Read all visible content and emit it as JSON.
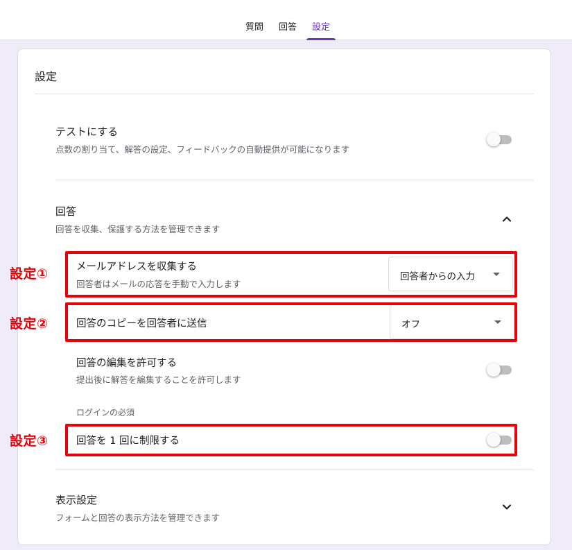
{
  "tabs": [
    {
      "label": "質問"
    },
    {
      "label": "回答"
    },
    {
      "label": "設定"
    }
  ],
  "settings_title": "設定",
  "quiz": {
    "title": "テストにする",
    "desc": "点数の割り当て、解答の設定、フィードバックの自動提供が可能になります",
    "toggle_on": false
  },
  "responses": {
    "title": "回答",
    "desc": "回答を収集、保護する方法を管理できます",
    "expanded": true,
    "collect_email": {
      "title": "メールアドレスを収集する",
      "desc": "回答者はメールの応答を手動で入力します",
      "value": "回答者からの入力"
    },
    "send_copy": {
      "title": "回答のコピーを回答者に送信",
      "value": "オフ"
    },
    "allow_edit": {
      "title": "回答の編集を許可する",
      "desc": "提出後に解答を編集することを許可します",
      "toggle_on": false
    },
    "login_required_label": "ログインの必須",
    "limit_one": {
      "title": "回答を 1 回に制限する",
      "toggle_on": false
    }
  },
  "presentation": {
    "title": "表示設定",
    "desc": "フォームと回答の表示方法を管理できます"
  },
  "callouts": [
    "設定①",
    "設定②",
    "設定③"
  ],
  "colors": {
    "accent": "#673ab7",
    "annotation_red": "#e8000b",
    "page_bg": "#f0ebf8"
  }
}
